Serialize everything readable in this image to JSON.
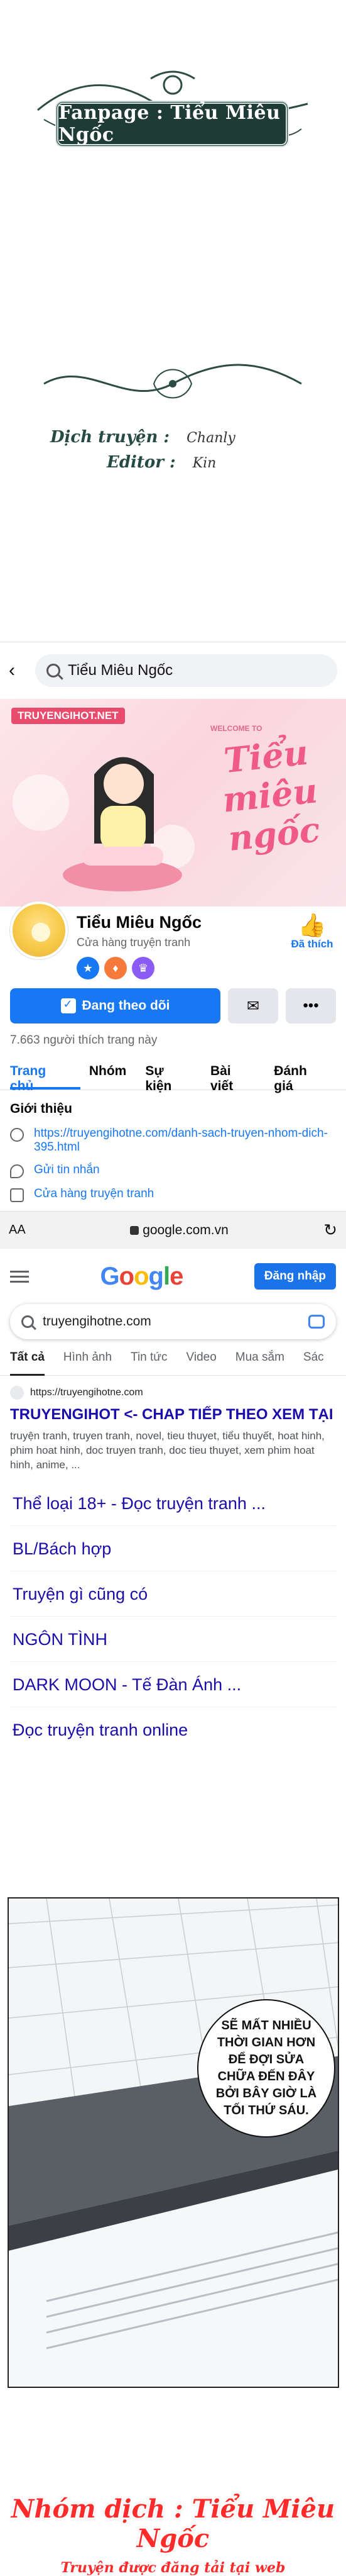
{
  "credits": {
    "fanpage": "Fanpage : Tiểu Miêu Ngốc",
    "translator_label": "Dịch truyện :",
    "translator_name": "Chanly",
    "editor_label": "Editor :",
    "editor_name": "Kin"
  },
  "fb": {
    "search_text": "Tiểu Miêu Ngốc",
    "cover_watermark": "TRUYENGIHOT.NET",
    "cover_welcome": "WELCOME TO",
    "cover_logo": "Tiểu miêu ngốc",
    "page_name": "Tiểu Miêu Ngốc",
    "page_category": "Cửa hàng truyện tranh",
    "liked_label": "Đã thích",
    "follow_button": "Đang theo dõi",
    "messenger_icon": "messenger-icon",
    "more_icon": "more-icon",
    "likes_count": "7.663 người thích trang này",
    "tabs": [
      "Trang chủ",
      "Nhóm",
      "Sự kiện",
      "Bài viết",
      "Đánh giá"
    ],
    "intro_title": "Giới thiệu",
    "intro_link": "https://truyengihotne.com/danh-sach-truyen-nhom-dich-395.html",
    "intro_message": "Gửi tin nhắn",
    "intro_category": "Cửa hàng truyện tranh"
  },
  "browser": {
    "aa": "AA",
    "url": "google.com.vn",
    "reload_icon": "reload-icon"
  },
  "google": {
    "logo": "Google",
    "login_button": "Đăng nhập",
    "query": "truyengihotne.com",
    "tabs": [
      "Tất cả",
      "Hình ảnh",
      "Tin tức",
      "Video",
      "Mua sắm",
      "Sác"
    ],
    "result_site": "https://truyengihotne.com",
    "result_title": "TRUYENGIHOT <- CHAP TIẾP THEO XEM TẠI ĐÂY NHA",
    "result_desc": "truyện tranh, truyen tranh, novel, tieu thuyet, tiểu thuyết, hoat hinh, phim hoat hinh, doc truyen tranh, doc tieu thuyet, xem phim hoat hinh, anime, ...",
    "sitelinks": [
      "Thể loại 18+ - Đọc truyện tranh ...",
      "BL/Bách hợp",
      "Truyện gì cũng có",
      "NGÔN TÌNH",
      "DARK MOON - Tế Đàn Ánh ...",
      "Đọc truyện tranh online"
    ]
  },
  "comic": {
    "speech": "SẼ MẤT NHIỀU THỜI GIAN HƠN ĐỂ ĐỢI SỬA CHỮA ĐẾN ĐÂY BỞI BÂY GIỜ LÀ TỐI THỨ SÁU."
  },
  "footer": {
    "line1": "Nhóm dịch : Tiểu Miêu Ngốc",
    "line2": "Truyện được đăng tải tại web TRUYENGIHOTNHAT.COM"
  },
  "colors": {
    "fb_blue": "#1877f2",
    "fanpage_bg": "#1f3b35",
    "footer_red": "#ff2a2a"
  }
}
